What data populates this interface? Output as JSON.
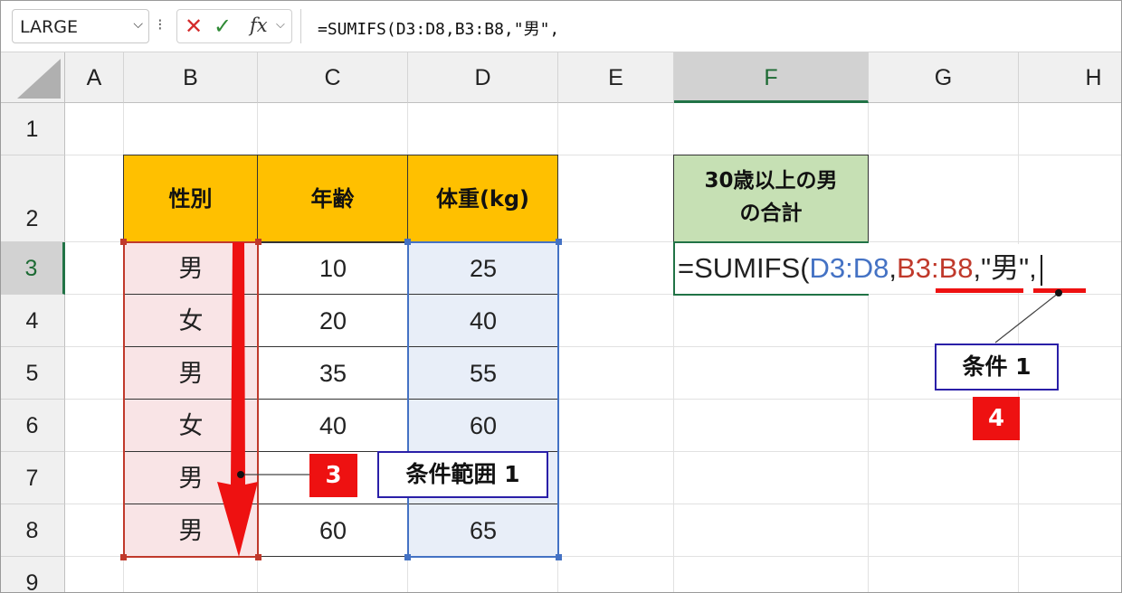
{
  "name_box": {
    "value": "LARGE"
  },
  "formula_bar": {
    "formula": "=SUMIFS(D3:D8,B3:B8,\"男\","
  },
  "columns": [
    "A",
    "B",
    "C",
    "D",
    "E",
    "F",
    "G",
    "H"
  ],
  "rows": [
    "1",
    "2",
    "3",
    "4",
    "5",
    "6",
    "7",
    "8",
    "9"
  ],
  "table": {
    "headers": [
      "性別",
      "年齢",
      "体重(kg)"
    ],
    "rows": [
      [
        "男",
        "10",
        "25"
      ],
      [
        "女",
        "20",
        "40"
      ],
      [
        "男",
        "35",
        "55"
      ],
      [
        "女",
        "40",
        "60"
      ],
      [
        "男",
        "",
        ""
      ],
      [
        "男",
        "60",
        "65"
      ]
    ]
  },
  "summary": {
    "header_line1": "30歳以上の男",
    "header_line2": "の合計"
  },
  "edit_cell": {
    "prefix": "=SUMIFS(",
    "arg1": "D3:D8",
    "comma1": ",",
    "arg2": "B3:B8",
    "arg3": ",\"男\","
  },
  "annotations": {
    "range_label": "条件範囲 1",
    "range_badge": "3",
    "criteria_label": "条件 1",
    "criteria_badge": "4"
  },
  "colors": {
    "header_fill": "#ffc000",
    "summary_fill": "#c6e0b4",
    "range_b_fill": "#f9e4e6",
    "range_d_fill": "#e8eef8",
    "ref_blue": "#4472c4",
    "ref_red": "#c0392b",
    "badge_red": "#ee1111",
    "label_border": "#2a1fa8"
  }
}
